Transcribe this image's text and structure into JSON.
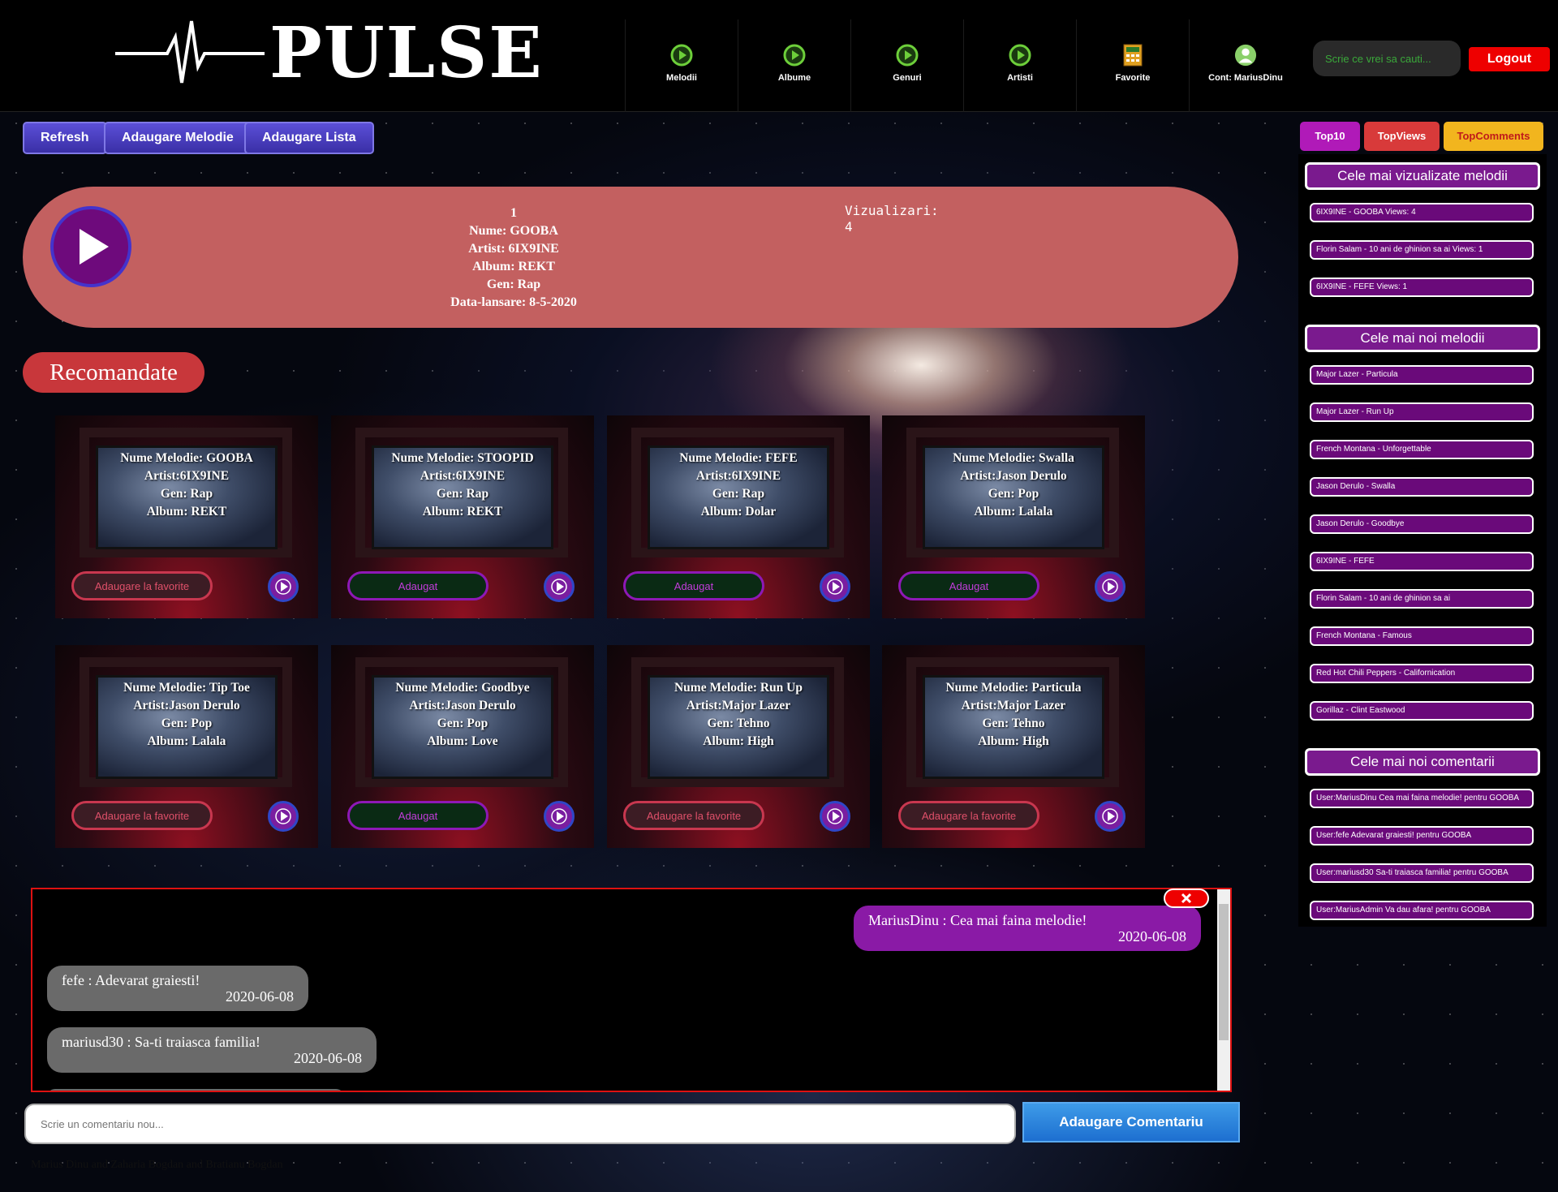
{
  "header": {
    "logo_text": "PULSE",
    "nav": [
      {
        "label": "Melodii",
        "icon": "play-circle-icon"
      },
      {
        "label": "Albume",
        "icon": "play-circle-icon"
      },
      {
        "label": "Genuri",
        "icon": "play-circle-icon"
      },
      {
        "label": "Artisti",
        "icon": "play-circle-icon"
      },
      {
        "label": "Favorite",
        "icon": "calculator-icon"
      },
      {
        "label": "Cont: MariusDinu",
        "icon": "user-icon"
      }
    ],
    "search_placeholder": "Scrie ce vrei sa cauti...",
    "logout_label": "Logout"
  },
  "toolbar": {
    "refresh": "Refresh",
    "add_song": "Adaugare Melodie",
    "add_list": "Adaugare Lista"
  },
  "tabs": {
    "top10": "Top10",
    "topviews": "TopViews",
    "topcomments": "TopComments"
  },
  "player": {
    "rank": "1",
    "name": "Nume: GOOBA",
    "artist": "Artist: 6IX9INE",
    "album": "Album: REKT",
    "genre": "Gen: Rap",
    "release": "Data-lansare: 8-5-2020",
    "views_label": "Vizualizari:",
    "views_value": "4"
  },
  "recommended_title": "Recomandate",
  "cards": [
    {
      "name": "Nume Melodie: GOOBA",
      "artist": "Artist:6IX9INE",
      "genre": "Gen: Rap",
      "album": "Album: REKT",
      "fav": "Adaugare la favorite",
      "fav_state": "add"
    },
    {
      "name": "Nume Melodie: STOOPID",
      "artist": "Artist:6IX9INE",
      "genre": "Gen: Rap",
      "album": "Album: REKT",
      "fav": "Adaugat",
      "fav_state": "done"
    },
    {
      "name": "Nume Melodie: FEFE",
      "artist": "Artist:6IX9INE",
      "genre": "Gen: Rap",
      "album": "Album: Dolar",
      "fav": "Adaugat",
      "fav_state": "done"
    },
    {
      "name": "Nume Melodie: Swalla",
      "artist": "Artist:Jason Derulo",
      "genre": "Gen: Pop",
      "album": "Album: Lalala",
      "fav": "Adaugat",
      "fav_state": "done"
    },
    {
      "name": "Nume Melodie: Tip Toe",
      "artist": "Artist:Jason Derulo",
      "genre": "Gen: Pop",
      "album": "Album: Lalala",
      "fav": "Adaugare la favorite",
      "fav_state": "add"
    },
    {
      "name": "Nume Melodie: Goodbye",
      "artist": "Artist:Jason Derulo",
      "genre": "Gen: Pop",
      "album": "Album: Love",
      "fav": "Adaugat",
      "fav_state": "done"
    },
    {
      "name": "Nume Melodie: Run Up",
      "artist": "Artist:Major Lazer",
      "genre": "Gen: Tehno",
      "album": "Album: High",
      "fav": "Adaugare la favorite",
      "fav_state": "add"
    },
    {
      "name": "Nume Melodie: Particula",
      "artist": "Artist:Major Lazer",
      "genre": "Gen: Tehno",
      "album": "Album: High",
      "fav": "Adaugare la favorite",
      "fav_state": "add"
    }
  ],
  "comments": [
    {
      "text": "MariusDinu : Cea mai faina melodie!",
      "date": "2020-06-08",
      "mine": true
    },
    {
      "text": "fefe : Adevarat graiesti!",
      "date": "2020-06-08",
      "mine": false
    },
    {
      "text": "mariusd30 : Sa-ti traiasca familia!",
      "date": "2020-06-08",
      "mine": false
    }
  ],
  "comment_input_placeholder": "Scrie un comentariu nou...",
  "add_comment_label": "Adaugare Comentariu",
  "footer": "Marius Dinu and Zaharia Bogdan and Bratianu Bogdan",
  "sidebar": {
    "most_viewed_title": "Cele mai vizualizate melodii",
    "most_viewed": [
      "6IX9INE - GOOBA Views: 4",
      "Florin Salam - 10 ani de ghinion sa ai Views: 1",
      "6IX9INE - FEFE Views: 1"
    ],
    "newest_title": "Cele mai noi melodii",
    "newest": [
      "Major Lazer - Particula",
      "Major Lazer - Run Up",
      "French Montana - Unforgettable",
      "Jason Derulo - Swalla",
      "Jason Derulo - Goodbye",
      "6IX9INE - FEFE",
      "Florin Salam - 10 ani de ghinion sa ai",
      "French Montana - Famous",
      "Red Hot Chili Peppers - Californication",
      "Gorillaz - Clint Eastwood"
    ],
    "comments_title": "Cele mai noi comentarii",
    "newest_comments": [
      "User:MariusDinu Cea mai faina melodie! pentru GOOBA",
      "User:fefe Adevarat graiesti! pentru GOOBA",
      "User:mariusd30 Sa-ti traiasca familia! pentru GOOBA",
      "User:MariusAdmin Va dau afara! pentru GOOBA"
    ]
  },
  "colors": {
    "player_bg": "#c36060",
    "accent_purple": "#7a1a8e",
    "logout_red": "#ee0000",
    "tab_top10": "#b01ab8",
    "tab_topviews": "#d83a3a",
    "tab_topcomments": "#f2b51e"
  }
}
